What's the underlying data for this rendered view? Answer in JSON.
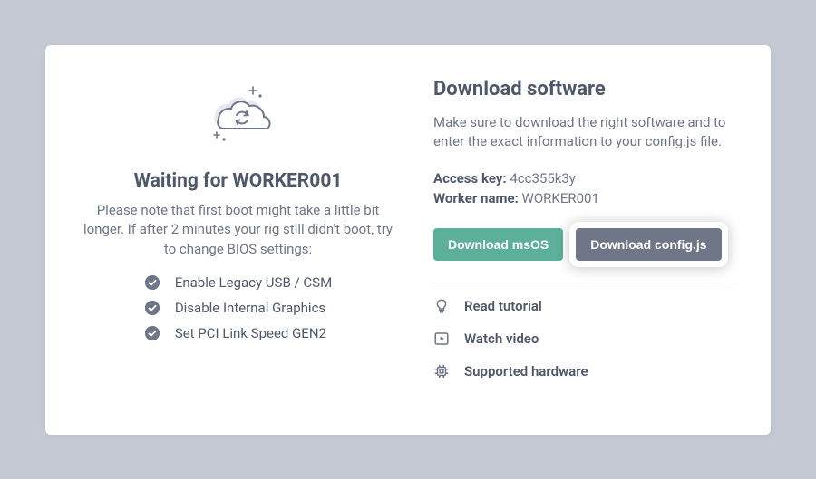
{
  "left": {
    "title": "Waiting for WORKER001",
    "description": "Please note that first boot might take a little bit longer. If after 2 minutes your rig still didn't boot, try to change BIOS settings:",
    "bios_items": [
      "Enable Legacy USB / CSM",
      "Disable Internal Graphics",
      "Set PCI Link Speed GEN2"
    ]
  },
  "right": {
    "title": "Download software",
    "description": "Make sure to download the right software and to enter the exact information to your config.js file.",
    "access_key_label": "Access key:",
    "access_key_value": "4cc355k3y",
    "worker_name_label": "Worker name:",
    "worker_name_value": "WORKER001",
    "btn_download_os": "Download msOS",
    "btn_download_config": "Download config.js",
    "links": {
      "tutorial": "Read tutorial",
      "video": "Watch video",
      "hardware": "Supported hardware"
    }
  }
}
